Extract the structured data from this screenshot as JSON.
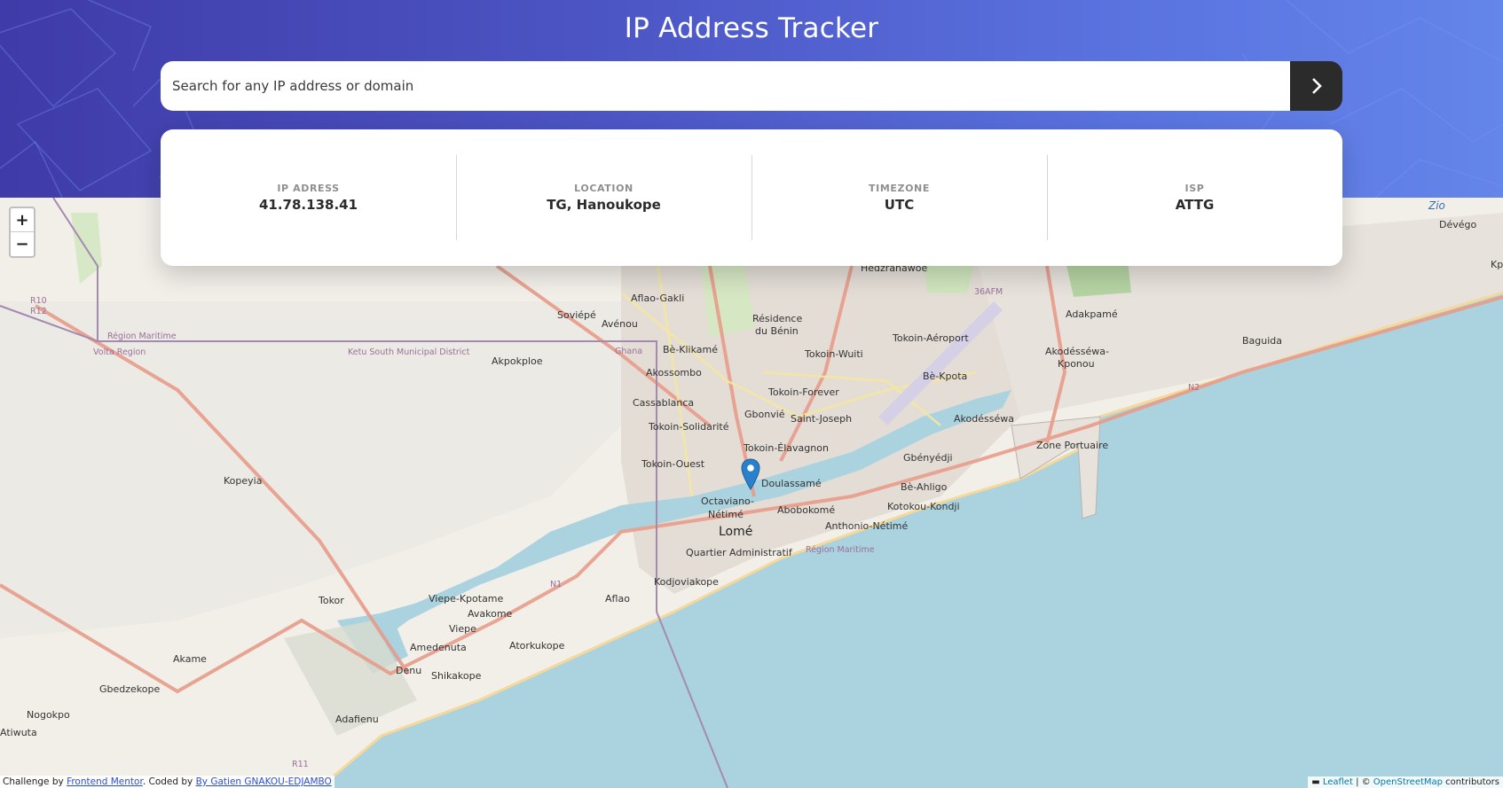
{
  "header": {
    "title": "IP Address Tracker"
  },
  "search": {
    "placeholder": "Search for any IP address or domain",
    "value": "",
    "submit_icon": "chevron-right-icon"
  },
  "info": [
    {
      "label": "IP ADRESS",
      "value": "41.78.138.41"
    },
    {
      "label": "LOCATION",
      "value": "TG, Hanoukope"
    },
    {
      "label": "TIMEZONE",
      "value": "UTC"
    },
    {
      "label": "ISP",
      "value": "ATTG"
    }
  ],
  "map": {
    "zoom_in": "+",
    "zoom_out": "−",
    "labels": {
      "lome": "Lomé",
      "doulassame": "Doulassamé",
      "tokoin_elavagnon": "Tokoin-Élavagnon",
      "tokoin_ouest": "Tokoin-Ouest",
      "octaviano": "Octaviano-",
      "netime": "Nétimé",
      "abobokome": "Abobokomé",
      "quartier_admin": "Quartier Administratif",
      "kodjoviakope": "Kodjoviakope",
      "anthonio": "Anthonio-Nétimé",
      "kotokou": "Kotokou-Kondji",
      "be_ahligo": "Bè-Ahligo",
      "gbenyedji": "Gbényédji",
      "zone_portuaire": "Zone Portuaire",
      "akodessewa": "Akodésséwa",
      "akodessewa_kponou": "Akodésséwa-",
      "kponou": "Kponou",
      "be_kpota": "Bè-Kpota",
      "tokoin_aeroport": "Tokoin-Aéroport",
      "tokoin_wuiti": "Tokoin-Wuiti",
      "tokoin_forever": "Tokoin-Forever",
      "gbonvie": "Gbonvié",
      "saint_joseph": "Saint-Joseph",
      "tokoin_solidarite": "Tokoin-Solidarité",
      "cassablanca": "Cassablanca",
      "akossombo": "Akossombo",
      "be_klikame": "Bè-Klikamé",
      "residence": "Résidence",
      "du_benin": "du Bénin",
      "avenou": "Avénou",
      "afflao_gakli": "Aflao-Gakli",
      "soviepe": "Soviépé",
      "akpokploe": "Akpokploe",
      "adakpame": "Adakpamé",
      "baguida": "Baguida",
      "hedzranawoe": "Hedzranawoe",
      "devego": "Dévégo",
      "zio": "Zio",
      "kopeyia": "Kopeyia",
      "tokor": "Tokor",
      "aflao": "Aflao",
      "viepe_kpotame": "Viepe-Kpotame",
      "avakome": "Avakome",
      "viepe": "Viepe",
      "amedenuta": "Amedenuta",
      "atorkukope": "Atorkukope",
      "denu": "Denu",
      "shikakope": "Shikakope",
      "akame": "Akame",
      "gbedzekope": "Gbedzekope",
      "nogokpo": "Nogokpo",
      "adafienu": "Adafienu",
      "atiwuta": "Atiwuta",
      "region_maritime": "Région Maritime",
      "volta_region": "Volta Region",
      "ketu_south": "Ketu South Municipal District",
      "ghana": "Ghana",
      "region_maritime_2": "Région Maritime",
      "r10": "R10",
      "r12": "R12",
      "r11": "R11",
      "n1": "N1",
      "n2": "N2",
      "36afm": "36AFM",
      "kp": "Kp"
    }
  },
  "footer": {
    "challenge_prefix": "Challenge by ",
    "challenge_link": "Frontend Mentor",
    "coded_prefix": ". Coded by ",
    "coded_link": "By Gatien GNAKOU-EDJAMBO",
    "leaflet": "Leaflet",
    "osm_prefix": " | © ",
    "osm_link": "OpenStreetMap",
    "osm_suffix": " contributors"
  },
  "colors": {
    "accent_dark": "#2b2b2b",
    "header_start": "#3f3ba8",
    "header_end": "#6485ea",
    "sea": "#aad3df",
    "marker": "#2a81cb"
  }
}
